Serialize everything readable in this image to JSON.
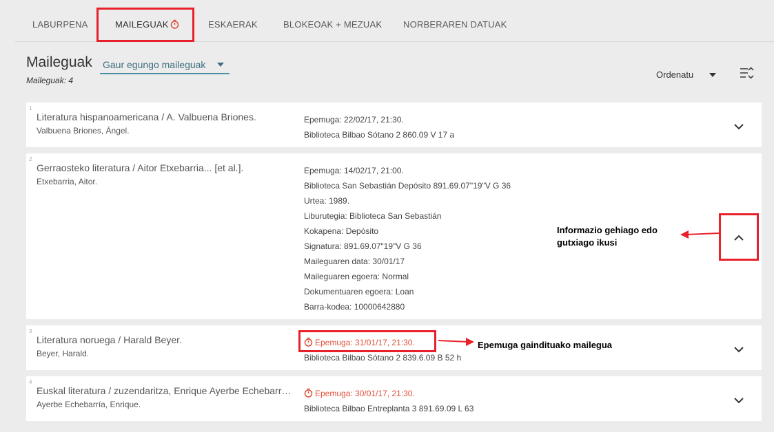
{
  "tabs": [
    {
      "label": "LABURPENA"
    },
    {
      "label": "MAILEGUAK"
    },
    {
      "label": "ESKAERAK"
    },
    {
      "label": "BLOKEOAK + MEZUAK"
    },
    {
      "label": "NORBERAREN DATUAK"
    }
  ],
  "header": {
    "title": "Maileguak",
    "count": "Maileguak: 4",
    "filter": "Gaur egungo maileguak",
    "sort": "Ordenatu"
  },
  "loans": [
    {
      "index": "1",
      "title": "Literatura hispanoamericana / A. Valbuena Briones.",
      "author": "Valbuena Briones, Ángel.",
      "due": "Epemuga: 22/02/17, 21:30.",
      "location": "Biblioteca Bilbao Sótano 2 860.09 V 17 a"
    },
    {
      "index": "2",
      "title": "Gerraosteko literatura / Aitor Etxebarria... [et al.].",
      "author": "Etxebarria, Aitor.",
      "due": "Epemuga: 14/02/17, 21:00.",
      "location": "Biblioteca San Sebastián Depósito 891.69.07\"19\"V G 36",
      "year": "Urtea: 1989.",
      "library": "Liburutegia: Biblioteca San Sebastián",
      "shelf": "Kokapena: Depósito",
      "signature": "Signatura: 891.69.07\"19\"V G 36",
      "loan_date": "Maileguaren data: 30/01/17",
      "loan_status": "Maileguaren egoera: Normal",
      "doc_status": "Dokumentuaren egoera: Loan",
      "barcode": "Barra-kodea: 10000642880"
    },
    {
      "index": "3",
      "title": "Literatura noruega / Harald Beyer.",
      "author": "Beyer, Harald.",
      "due": "Epemuga: 31/01/17, 21:30.",
      "location": "Biblioteca Bilbao Sótano 2 839.6.09 B 52 h"
    },
    {
      "index": "4",
      "title": "Euskal literatura / zuzendaritza, Enrique Ayerbe Echebarría...",
      "author": "Ayerbe Echebarría, Enrique.",
      "due": "Epemuga: 30/01/17, 21:30.",
      "location": "Biblioteca Bilbao Entreplanta 3 891.69.09 L 63"
    }
  ],
  "annotations": {
    "more_info_line1": "Informazio gehiago edo",
    "more_info_line2": "gutxiago ikusi",
    "overdue": "Epemuga gaindituako mailegua"
  },
  "colors": {
    "overdue": "#e0503a",
    "accent": "#4a8fa6",
    "highlight": "#e8202a"
  },
  "icons": [
    "stopwatch-icon",
    "chevron-down-icon",
    "chevron-up-icon",
    "sort-options-icon"
  ]
}
